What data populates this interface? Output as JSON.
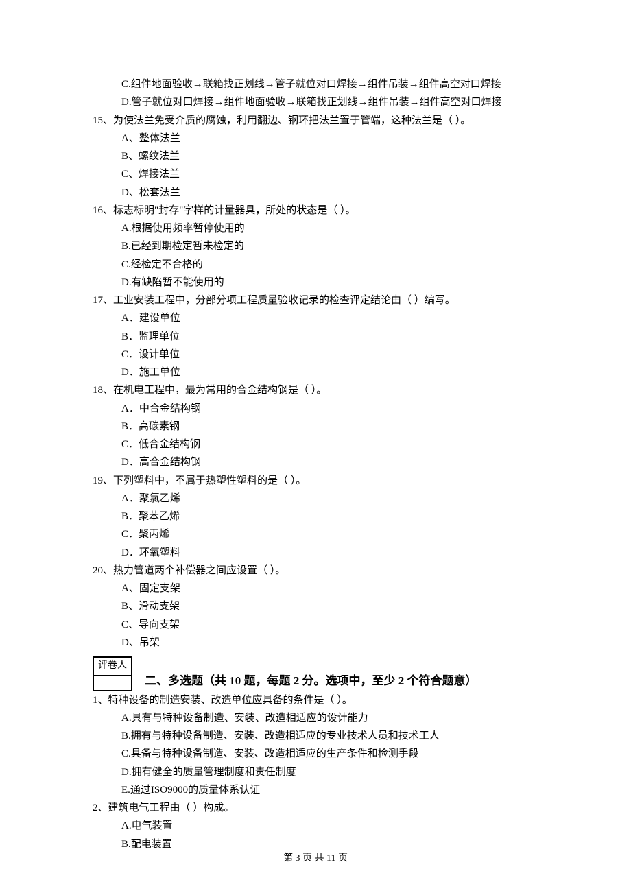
{
  "topOptions": {
    "c": "C.组件地面验收→联箱找正划线→管子就位对口焊接→组件吊装→组件高空对口焊接",
    "d": "D.管子就位对口焊接→组件地面验收→联箱找正划线→组件吊装→组件高空对口焊接"
  },
  "questions": [
    {
      "num": "15、",
      "stem": "为使法兰免受介质的腐蚀，利用翻边、钢环把法兰置于管端，这种法兰是（    ）。",
      "opts": [
        "A、整体法兰",
        "B、螺纹法兰",
        "C、焊接法兰",
        "D、松套法兰"
      ]
    },
    {
      "num": "16、",
      "stem": "标志标明\"封存\"字样的计量器具，所处的状态是（    ）。",
      "opts": [
        "A.根据使用频率暂停使用的",
        "B.已经到期检定暂未检定的",
        "C.经检定不合格的",
        "D.有缺陷暂不能使用的"
      ]
    },
    {
      "num": "17、",
      "stem": "工业安装工程中，分部分项工程质量验收记录的检查评定结论由（    ）编写。",
      "opts": [
        "A．建设单位",
        "B．监理单位",
        "C．设计单位",
        "D．施工单位"
      ]
    },
    {
      "num": "18、",
      "stem": "在机电工程中，最为常用的合金结构钢是（    ）。",
      "opts": [
        "A．中合金结构钢",
        "B．高碳素钢",
        "C．低合金结构钢",
        "D．高合金结构钢"
      ]
    },
    {
      "num": "19、",
      "stem": "下列塑料中，不属于热塑性塑料的是（    ）。",
      "opts": [
        "A．聚氯乙烯",
        "B．聚苯乙烯",
        "C．聚丙烯",
        "D．环氧塑料"
      ]
    },
    {
      "num": "20、",
      "stem": "热力管道两个补偿器之间应设置（    ）。",
      "opts": [
        "A、固定支架",
        "B、滑动支架",
        "C、导向支架",
        "D、吊架"
      ]
    }
  ],
  "grader": {
    "label": "评卷人",
    "blank": ""
  },
  "section2": "二、多选题（共 10 题，每题 2 分。选项中，至少 2 个符合题意）",
  "multi": [
    {
      "num": "1、",
      "stem": "特种设备的制造安装、改造单位应具备的条件是（    ）。",
      "opts": [
        "A.具有与特种设备制造、安装、改造相适应的设计能力",
        "B.拥有与特种设备制造、安装、改造相适应的专业技术人员和技术工人",
        "C.具备与特种设备制造、安装、改造相适应的生产条件和检测手段",
        "D.拥有健全的质量管理制度和责任制度",
        "E.通过ISO9000的质量体系认证"
      ]
    },
    {
      "num": "2、",
      "stem": "建筑电气工程由（    ）构成。",
      "opts": [
        "A.电气装置",
        "B.配电装置"
      ]
    }
  ],
  "footer": "第 3 页 共 11 页"
}
